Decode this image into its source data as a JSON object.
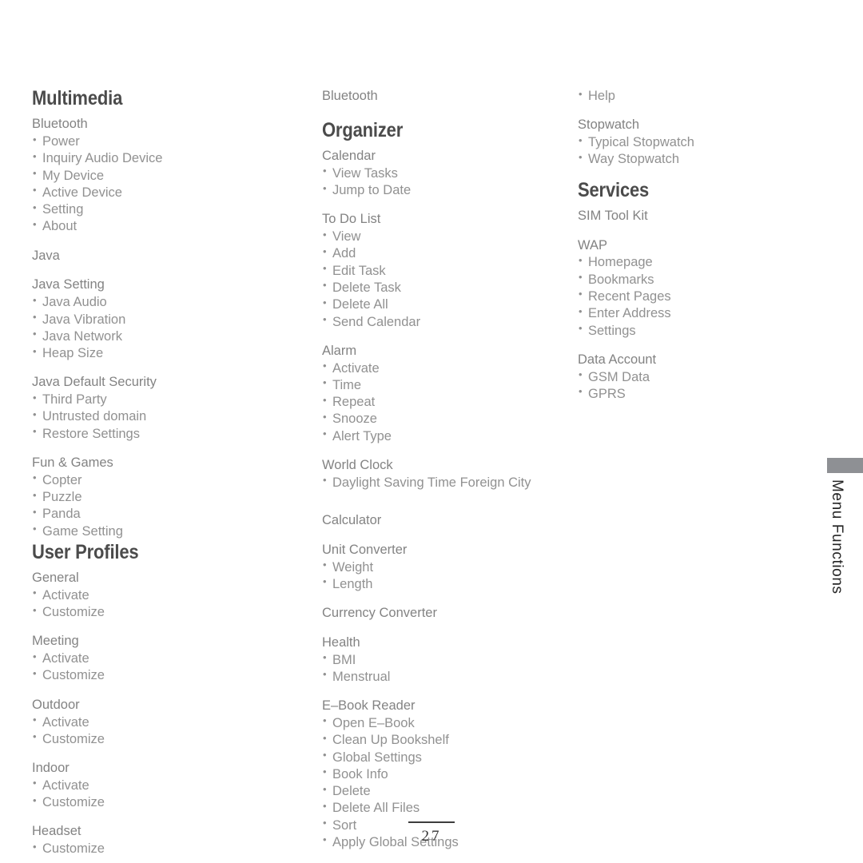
{
  "document": {
    "page_number": "27",
    "edge_tab_label": "Menu Functions",
    "accent_tab_color": "#8e9094",
    "heading_color": "#4b4b4b",
    "group_title_color": "#838383",
    "item_color": "#919191"
  },
  "columns": [
    {
      "id": "column-1",
      "blocks": [
        {
          "kind": "section",
          "title": "Multimedia"
        },
        {
          "kind": "group",
          "title": "Bluetooth",
          "items": [
            "Power",
            "Inquiry Audio Device",
            "My Device",
            "Active Device",
            "Setting",
            "About"
          ]
        },
        {
          "kind": "group",
          "title": "Java",
          "items": []
        },
        {
          "kind": "group",
          "title": "Java Setting",
          "items": [
            "Java Audio",
            "Java Vibration",
            "Java Network",
            "Heap Size"
          ]
        },
        {
          "kind": "group",
          "title": "Java Default Security",
          "items": [
            "Third Party",
            "Untrusted domain",
            "Restore Settings"
          ]
        },
        {
          "kind": "group",
          "title": "Fun & Games",
          "items": [
            "Copter",
            "Puzzle",
            "Panda",
            "Game Setting"
          ]
        },
        {
          "kind": "section",
          "title": "User Profiles"
        },
        {
          "kind": "group",
          "title": "General",
          "items": [
            "Activate",
            "Customize"
          ]
        },
        {
          "kind": "group",
          "title": "Meeting",
          "items": [
            "Activate",
            "Customize"
          ]
        },
        {
          "kind": "group",
          "title": "Outdoor",
          "items": [
            "Activate",
            "Customize"
          ]
        },
        {
          "kind": "group",
          "title": "Indoor",
          "items": [
            "Activate",
            "Customize"
          ]
        },
        {
          "kind": "group",
          "title": "Headset",
          "items": [
            "Customize"
          ]
        }
      ]
    },
    {
      "id": "column-2",
      "blocks": [
        {
          "kind": "group",
          "title": "Bluetooth",
          "items": []
        },
        {
          "kind": "section",
          "title": "Organizer"
        },
        {
          "kind": "group",
          "title": "Calendar",
          "items": [
            "View Tasks",
            "Jump to Date"
          ]
        },
        {
          "kind": "group",
          "title": "To Do List",
          "items": [
            "View",
            "Add",
            "Edit Task",
            "Delete Task",
            "Delete All",
            "Send Calendar"
          ]
        },
        {
          "kind": "group",
          "title": "Alarm",
          "items": [
            "Activate",
            "Time",
            "Repeat",
            "Snooze",
            "Alert Type"
          ]
        },
        {
          "kind": "group",
          "title": "World Clock",
          "items": [
            "Daylight Saving Time Foreign City"
          ]
        },
        {
          "kind": "group",
          "title": "Calculator",
          "items": []
        },
        {
          "kind": "group",
          "title": "Unit Converter",
          "items": [
            "Weight",
            "Length"
          ]
        },
        {
          "kind": "group",
          "title": "Currency Converter",
          "items": []
        },
        {
          "kind": "group",
          "title": "Health",
          "items": [
            "BMI",
            "Menstrual"
          ]
        },
        {
          "kind": "group",
          "title": "E–Book Reader",
          "items": [
            "Open E–Book",
            "Clean Up Bookshelf",
            "Global Settings",
            "Book Info",
            "Delete",
            "Delete All Files",
            "Sort",
            "Apply Global Settings"
          ]
        }
      ]
    },
    {
      "id": "column-3",
      "blocks": [
        {
          "kind": "group",
          "title": "",
          "items": [
            "Help"
          ]
        },
        {
          "kind": "group",
          "title": "Stopwatch",
          "items": [
            "Typical Stopwatch",
            "Way Stopwatch"
          ]
        },
        {
          "kind": "section",
          "title": "Services"
        },
        {
          "kind": "group",
          "title": "SIM Tool Kit",
          "items": []
        },
        {
          "kind": "group",
          "title": "WAP",
          "items": [
            "Homepage",
            "Bookmarks",
            "Recent Pages",
            "Enter Address",
            "Settings"
          ]
        },
        {
          "kind": "group",
          "title": "Data Account",
          "items": [
            "GSM Data",
            "GPRS"
          ]
        }
      ]
    }
  ]
}
